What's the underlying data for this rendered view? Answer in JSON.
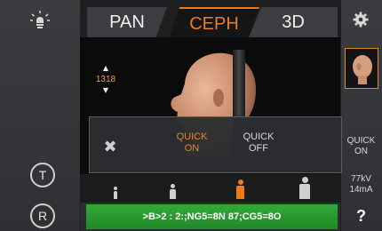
{
  "tabs": [
    "PAN",
    "CEPH",
    "3D"
  ],
  "active_tab": "CEPH",
  "height": {
    "value": "1318",
    "up_icon": "up-arrow-icon",
    "down_icon": "down-arrow-icon"
  },
  "quick_panel": {
    "close_icon": "close-icon",
    "on_line1": "QUICK",
    "on_line2": "ON",
    "off_line1": "QUICK",
    "off_line2": "OFF"
  },
  "patient_sizes": [
    "child-small",
    "child",
    "adult",
    "adult-large"
  ],
  "selected_patient_size": "adult",
  "status_text": ">B>2 : 2:;NG5=8N 87;CG5=8O",
  "left_buttons": {
    "lamp_icon": "lamp-icon",
    "t_label": "T",
    "r_label": "R"
  },
  "right_panel": {
    "gear_icon": "gear-icon",
    "quick_line1": "QUICK",
    "quick_line2": "ON",
    "kv": "77kV",
    "ma": "14mA",
    "help": "?"
  },
  "colors": {
    "accent": "#f07a1a",
    "status_green": "#2f9e34"
  }
}
